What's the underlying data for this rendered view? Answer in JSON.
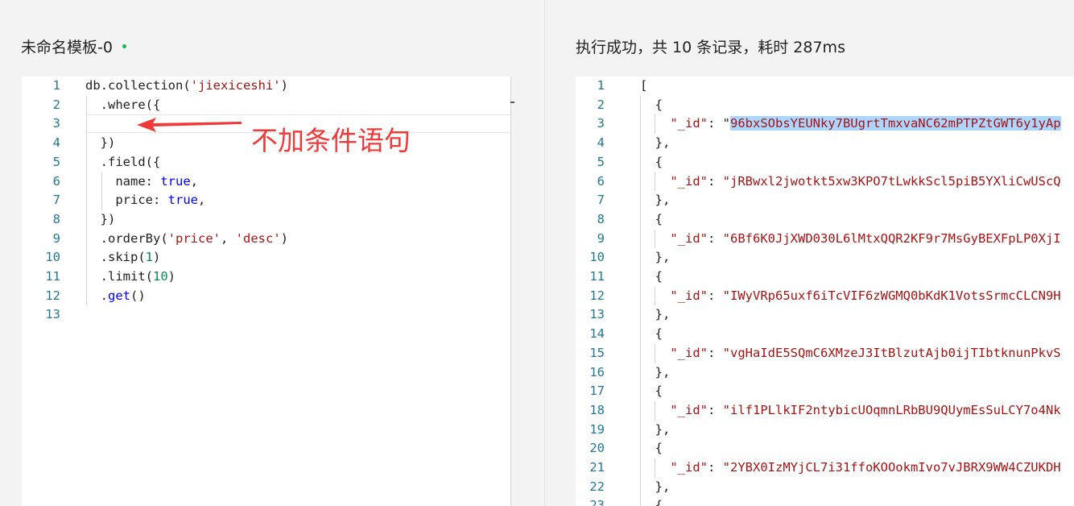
{
  "left_pane": {
    "title": "未命名模板-0",
    "annotation": "不加条件语句",
    "code_lines": [
      {
        "n": "1",
        "tokens": [
          [
            "db.collection(",
            ""
          ],
          [
            "'jiexiceshi'",
            "str"
          ],
          [
            ")",
            ""
          ]
        ]
      },
      {
        "n": "2",
        "tokens": [
          [
            "  .where({",
            ""
          ]
        ]
      },
      {
        "n": "3",
        "tokens": [
          [
            "",
            ""
          ]
        ]
      },
      {
        "n": "4",
        "tokens": [
          [
            "  })",
            ""
          ]
        ]
      },
      {
        "n": "5",
        "tokens": [
          [
            "  .field({",
            ""
          ]
        ]
      },
      {
        "n": "6",
        "tokens": [
          [
            "    name: ",
            ""
          ],
          [
            "true",
            "kw"
          ],
          [
            ",",
            ""
          ]
        ]
      },
      {
        "n": "7",
        "tokens": [
          [
            "    price: ",
            ""
          ],
          [
            "true",
            "kw"
          ],
          [
            ",",
            ""
          ]
        ]
      },
      {
        "n": "8",
        "tokens": [
          [
            "  })",
            ""
          ]
        ]
      },
      {
        "n": "9",
        "tokens": [
          [
            "  .orderBy(",
            ""
          ],
          [
            "'price'",
            "str"
          ],
          [
            ", ",
            ""
          ],
          [
            "'desc'",
            "str"
          ],
          [
            ")",
            ""
          ]
        ]
      },
      {
        "n": "10",
        "tokens": [
          [
            "  .skip(",
            ""
          ],
          [
            "1",
            "num"
          ],
          [
            ")",
            ""
          ]
        ]
      },
      {
        "n": "11",
        "tokens": [
          [
            "  .limit(",
            ""
          ],
          [
            "10",
            "num"
          ],
          [
            ")",
            ""
          ]
        ]
      },
      {
        "n": "12",
        "tokens": [
          [
            "  .",
            ""
          ],
          [
            "get",
            "kw"
          ],
          [
            "()",
            ""
          ]
        ]
      },
      {
        "n": "13",
        "tokens": [
          [
            "",
            ""
          ]
        ]
      }
    ]
  },
  "right_pane": {
    "title": "执行成功，共 10 条记录，耗时 287ms",
    "result_lines": [
      {
        "n": "1",
        "tokens": [
          [
            "[",
            ""
          ]
        ]
      },
      {
        "n": "2",
        "tokens": [
          [
            "  {",
            ""
          ]
        ]
      },
      {
        "n": "3",
        "tokens": [
          [
            "    ",
            ""
          ],
          [
            "\"_id\"",
            "key"
          ],
          [
            ": \"",
            ""
          ],
          [
            "96bxSObsYEUNky7BUgrtTmxvaNC62mPTPZtGWT6y1yAp",
            "sel"
          ]
        ]
      },
      {
        "n": "4",
        "tokens": [
          [
            "  },",
            ""
          ]
        ]
      },
      {
        "n": "5",
        "tokens": [
          [
            "  {",
            ""
          ]
        ]
      },
      {
        "n": "6",
        "tokens": [
          [
            "    ",
            ""
          ],
          [
            "\"_id\"",
            "key"
          ],
          [
            ": ",
            ""
          ],
          [
            "\"jRBwxl2jwotkt5xw3KPO7tLwkkScl5piB5YXliCwUScQ",
            "val"
          ]
        ]
      },
      {
        "n": "7",
        "tokens": [
          [
            "  },",
            ""
          ]
        ]
      },
      {
        "n": "8",
        "tokens": [
          [
            "  {",
            ""
          ]
        ]
      },
      {
        "n": "9",
        "tokens": [
          [
            "    ",
            ""
          ],
          [
            "\"_id\"",
            "key"
          ],
          [
            ": ",
            ""
          ],
          [
            "\"6Bf6K0JjXWD030L6lMtxQQR2KF9r7MsGyBEXFpLP0XjI",
            "val"
          ]
        ]
      },
      {
        "n": "10",
        "tokens": [
          [
            "  },",
            ""
          ]
        ]
      },
      {
        "n": "11",
        "tokens": [
          [
            "  {",
            ""
          ]
        ]
      },
      {
        "n": "12",
        "tokens": [
          [
            "    ",
            ""
          ],
          [
            "\"_id\"",
            "key"
          ],
          [
            ": ",
            ""
          ],
          [
            "\"IWyVRp65uxf6iTcVIF6zWGMQ0bKdK1VotsSrmcCLCN9H",
            "val"
          ]
        ]
      },
      {
        "n": "13",
        "tokens": [
          [
            "  },",
            ""
          ]
        ]
      },
      {
        "n": "14",
        "tokens": [
          [
            "  {",
            ""
          ]
        ]
      },
      {
        "n": "15",
        "tokens": [
          [
            "    ",
            ""
          ],
          [
            "\"_id\"",
            "key"
          ],
          [
            ": ",
            ""
          ],
          [
            "\"vgHaIdE5SQmC6XMzeJ3ItBlzutAjb0ijTIbtknunPkvS",
            "val"
          ]
        ]
      },
      {
        "n": "16",
        "tokens": [
          [
            "  },",
            ""
          ]
        ]
      },
      {
        "n": "17",
        "tokens": [
          [
            "  {",
            ""
          ]
        ]
      },
      {
        "n": "18",
        "tokens": [
          [
            "    ",
            ""
          ],
          [
            "\"_id\"",
            "key"
          ],
          [
            ": ",
            ""
          ],
          [
            "\"ilf1PLlkIF2ntybicUOqmnLRbBU9QUymEsSuLCY7o4Nk",
            "val"
          ]
        ]
      },
      {
        "n": "19",
        "tokens": [
          [
            "  },",
            ""
          ]
        ]
      },
      {
        "n": "20",
        "tokens": [
          [
            "  {",
            ""
          ]
        ]
      },
      {
        "n": "21",
        "tokens": [
          [
            "    ",
            ""
          ],
          [
            "\"_id\"",
            "key"
          ],
          [
            ": ",
            ""
          ],
          [
            "\"2YBX0IzMYjCL7i31ffoKOOokmIvo7vJBRX9WW4CZUKDH",
            "val"
          ]
        ]
      },
      {
        "n": "22",
        "tokens": [
          [
            "  },",
            ""
          ]
        ]
      },
      {
        "n": "23",
        "tokens": [
          [
            "  {",
            ""
          ]
        ]
      }
    ]
  }
}
